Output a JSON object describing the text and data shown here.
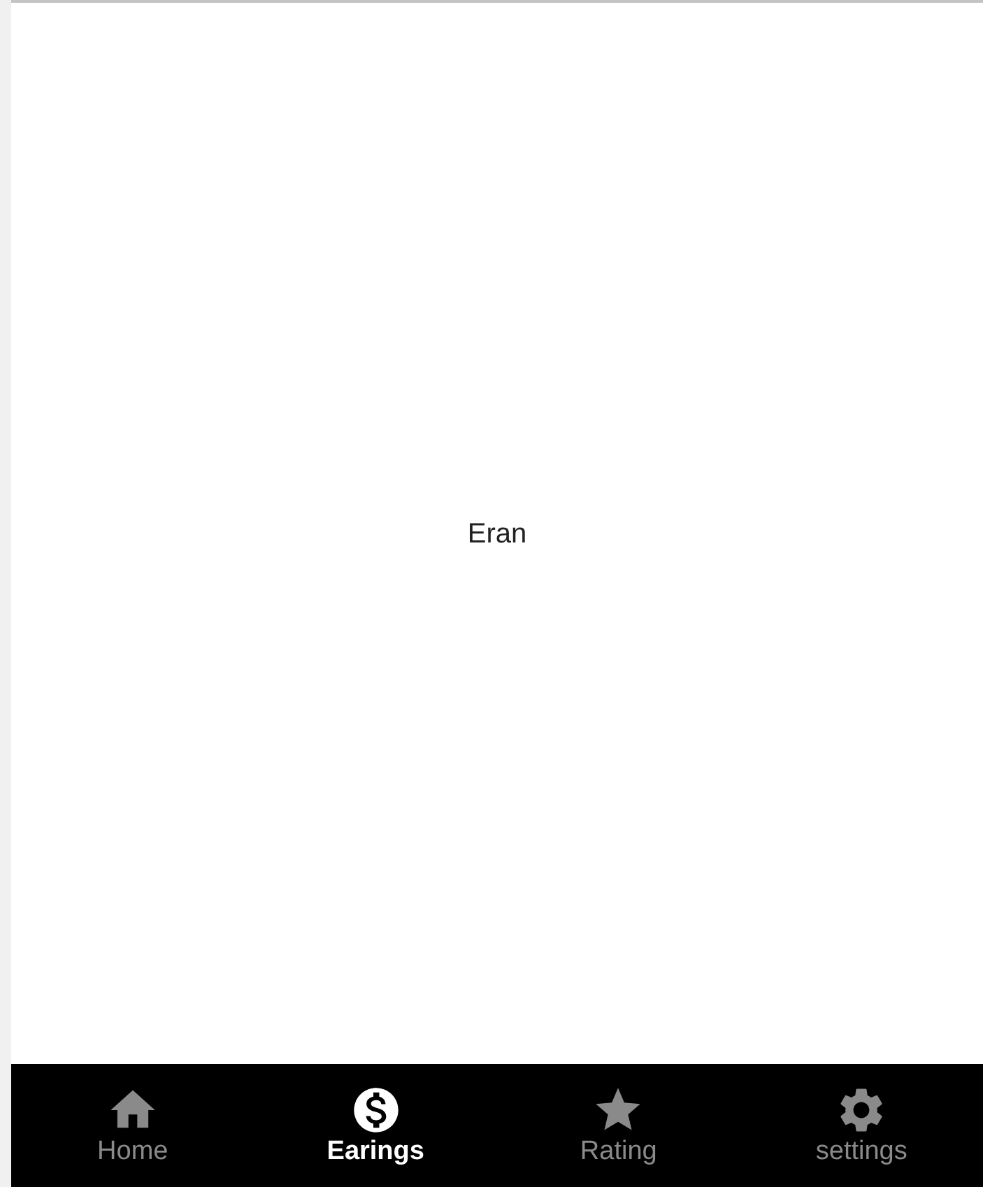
{
  "content": {
    "text": "Eran"
  },
  "tabs": [
    {
      "label": "Home",
      "selected": false
    },
    {
      "label": "Earings",
      "selected": true
    },
    {
      "label": "Rating",
      "selected": false
    },
    {
      "label": "settings",
      "selected": false
    }
  ]
}
